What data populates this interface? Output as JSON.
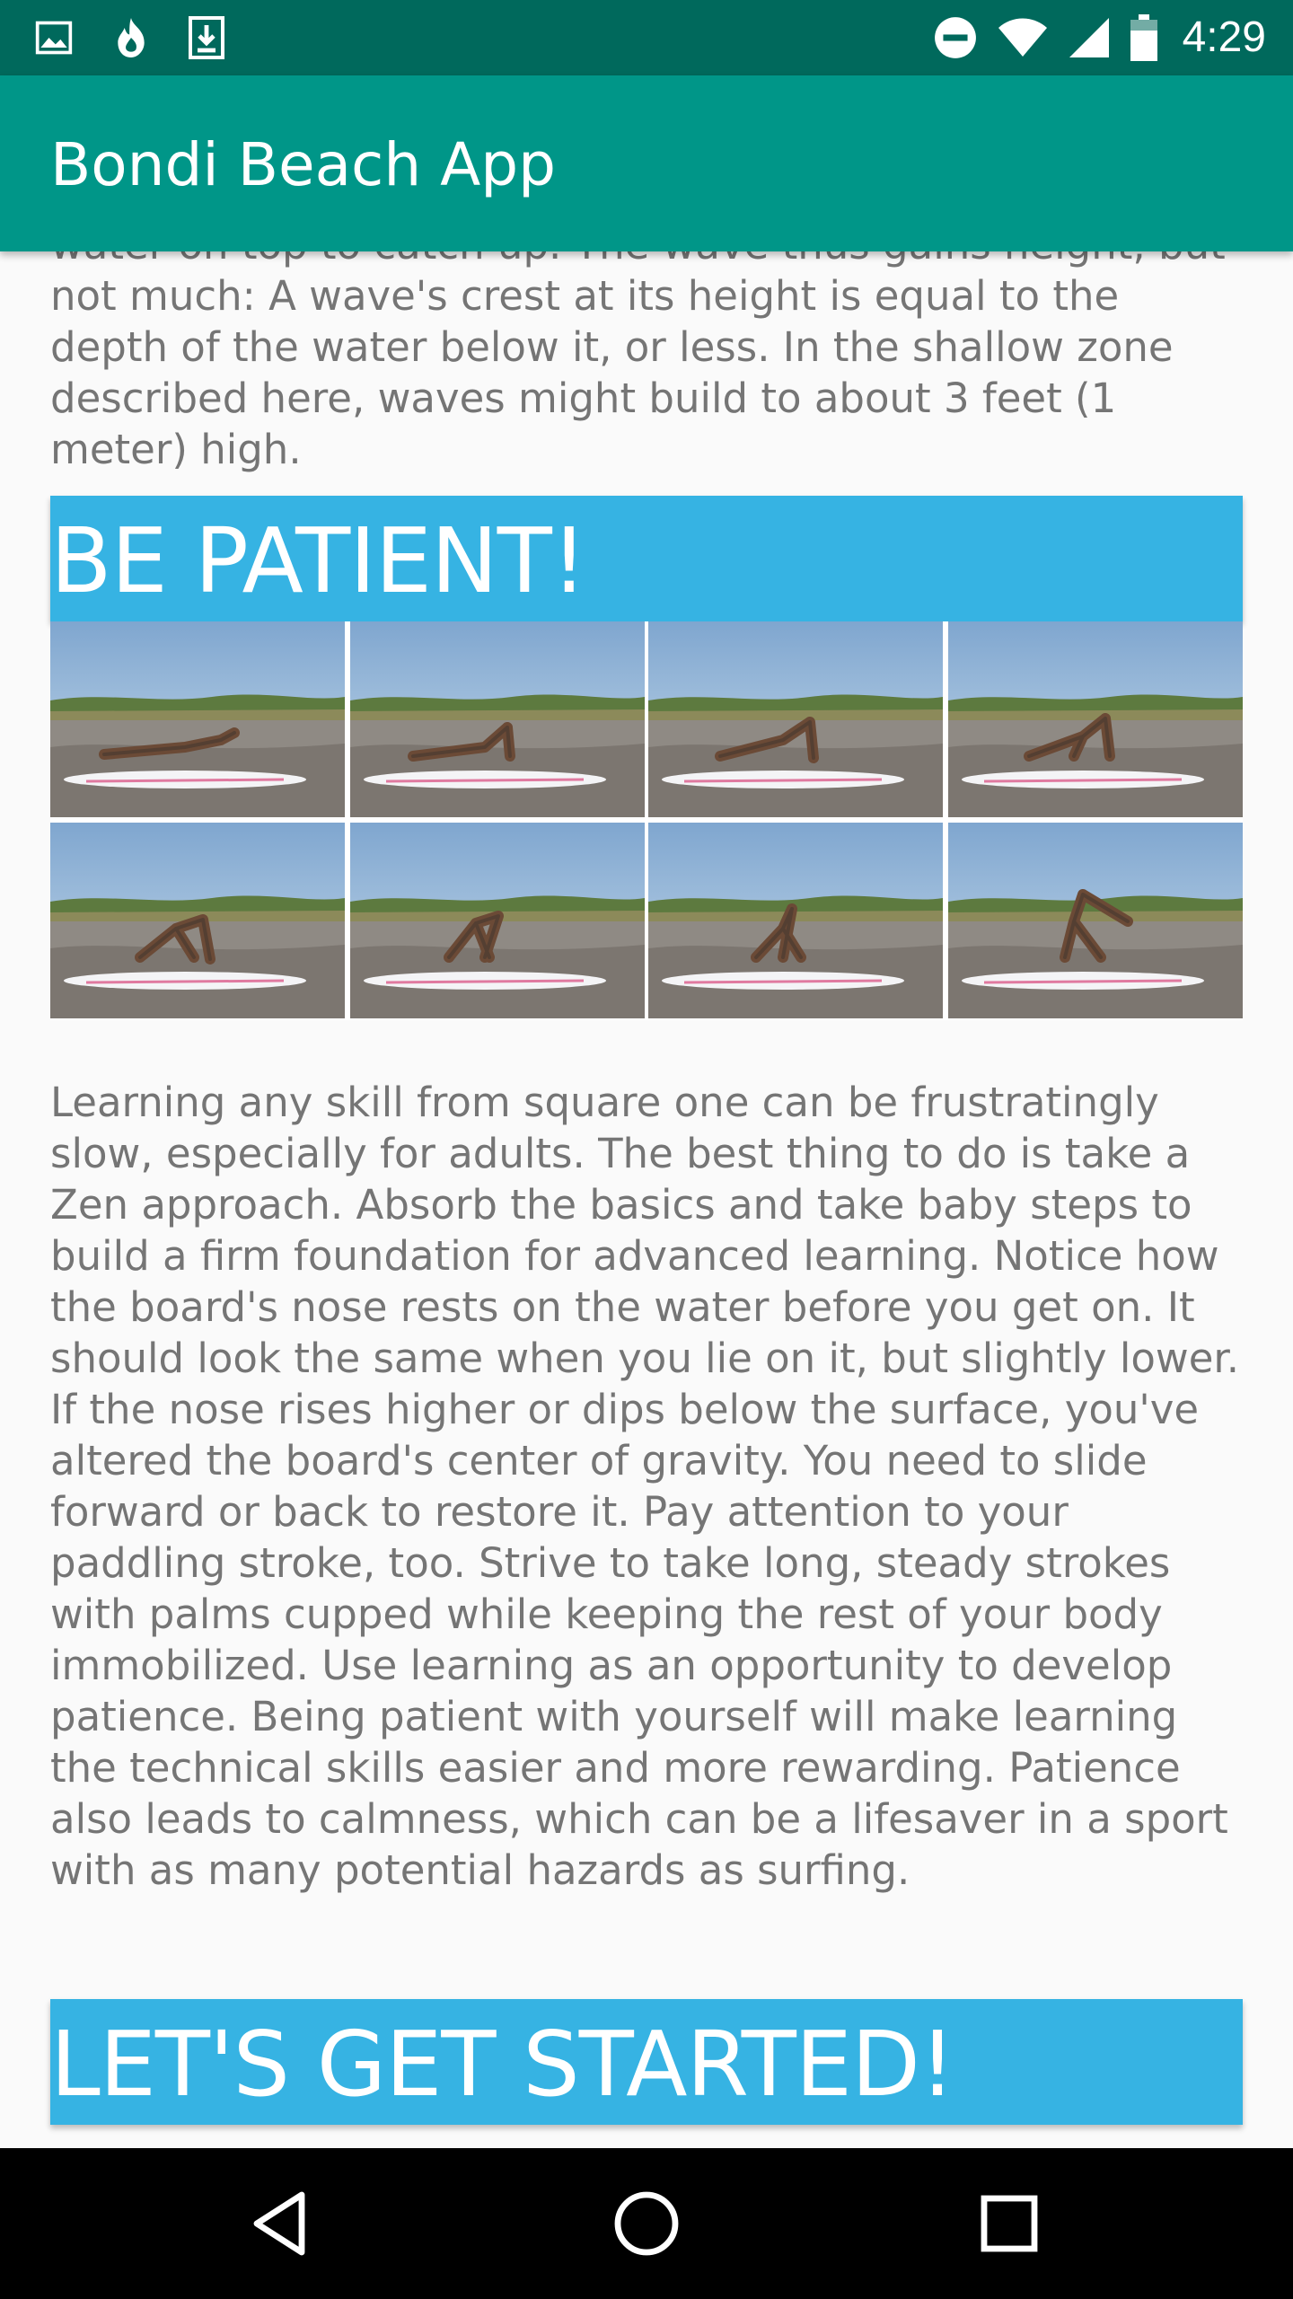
{
  "status_bar": {
    "time": "4:29",
    "left_icons": [
      "image-icon",
      "flame-icon",
      "download-icon"
    ],
    "right_icons": [
      "do-not-disturb-icon",
      "wifi-icon",
      "signal-icon",
      "battery-icon"
    ]
  },
  "app_bar": {
    "title": "Bondi Beach App",
    "color": "#009688"
  },
  "content": {
    "top_paragraph": "water on top to catch up. The wave thus gains height, but not much: A wave's crest at its height is equal to the depth of the water below it, or less. In the shallow zone described here, waves might build to about 3 feet (1 meter) high.",
    "section_1": {
      "heading": "BE PATIENT!",
      "photos": [
        "Surfer lying prone on board",
        "Surfer pressing up on board",
        "Surfer arching up on board",
        "Surfer bringing knee forward",
        "Surfer stepping foot forward",
        "Surfer crouching on board",
        "Surfer rising to stance",
        "Surfer standing on board"
      ],
      "paragraph": "Learning any skill from square one can be frustratingly slow, especially for adults. The best thing to do is take a Zen approach. Absorb the basics and take baby steps to build a firm foundation for advanced learning.  Notice how the board's nose rests on the water before you get on. It should look the same when you lie on it, but slightly lower. If the nose rises higher or dips below the surface, you've altered the board's center of gravity. You need to slide forward or back to restore it. Pay attention to your paddling stroke, too. Strive to take long, steady strokes with palms cupped while keeping the rest of your body immobilized.  Use learning as an opportunity to develop patience. Being patient with yourself will make learning the technical skills easier and more rewarding. Patience also leads to calmness, which can be a lifesaver in a sport with as many potential hazards as surfing."
    },
    "section_2": {
      "heading": "LET'S GET STARTED!"
    },
    "banner_color": "#36b3e3"
  },
  "nav_bar": {
    "back": "back-icon",
    "home": "home-icon",
    "recents": "recents-icon"
  }
}
